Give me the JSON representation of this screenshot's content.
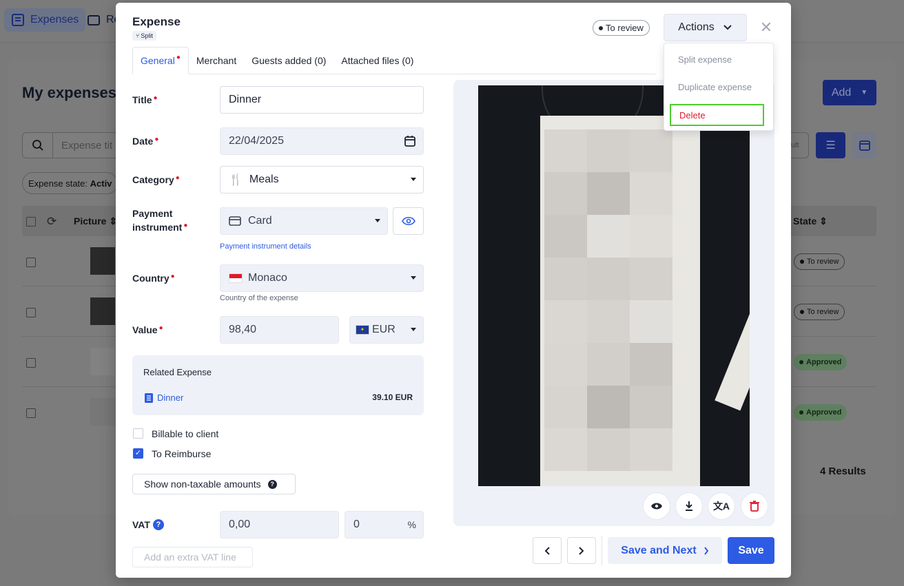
{
  "background": {
    "tabs": [
      {
        "label": "Expenses"
      },
      {
        "label": "Re"
      }
    ],
    "page_title": "My expenses",
    "search_placeholder": "Expense tit",
    "filter_label": "Expense state:",
    "filter_value": "Activ",
    "columns": {
      "picture": "Picture",
      "state": "State"
    },
    "rows": [
      {
        "state": "To review"
      },
      {
        "state": "To review"
      },
      {
        "state": "Approved"
      },
      {
        "state": "Approved"
      }
    ],
    "add_label": "Add",
    "results_label": "4 Results",
    "partial_button": "ult"
  },
  "modal": {
    "title": "Expense",
    "split_badge": "Split",
    "status": "To review",
    "actions_label": "Actions",
    "tabs": [
      {
        "label": "General",
        "required": true
      },
      {
        "label": "Merchant"
      },
      {
        "label": "Guests added (0)"
      },
      {
        "label": "Attached files (0)"
      }
    ],
    "form": {
      "title_label": "Title",
      "title_value": "Dinner",
      "date_label": "Date",
      "date_value": "22/04/2025",
      "category_label": "Category",
      "category_value": "Meals",
      "payment_label_line1": "Payment",
      "payment_label_line2": "instrument",
      "payment_value": "Card",
      "payment_details_link": "Payment instrument details",
      "country_label": "Country",
      "country_value": "Monaco",
      "country_hint": "Country of the expense",
      "value_label": "Value",
      "value_amount": "98,40",
      "currency": "EUR",
      "related_title": "Related Expense",
      "related_name": "Dinner",
      "related_amount": "39.10 EUR",
      "billable_label": "Billable to client",
      "billable_checked": false,
      "reimburse_label": "To Reimburse",
      "reimburse_checked": true,
      "non_taxable_button": "Show non-taxable amounts",
      "vat_label": "VAT",
      "vat_value": "0,00",
      "vat_rate": "0",
      "vat_percent": "%",
      "add_vat_button": "Add an extra VAT line"
    },
    "footer": {
      "save_next_label": "Save and Next",
      "save_label": "Save"
    },
    "actions_menu": [
      {
        "label": "Split expense"
      },
      {
        "label": "Duplicate expense"
      },
      {
        "label": "Delete",
        "highlighted": true
      }
    ],
    "colors": {
      "primary": "#2d5be3",
      "required": "#e1192b",
      "highlight": "#4ccf2e",
      "panel": "#eef1f7"
    }
  }
}
